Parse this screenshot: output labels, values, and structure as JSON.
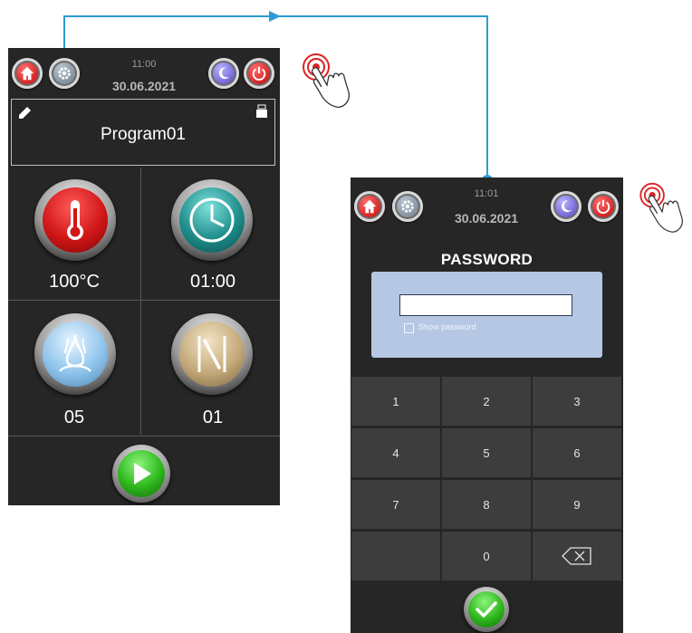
{
  "screen1": {
    "header": {
      "time": "11:00",
      "date": "30.06.2021"
    },
    "program": {
      "name": "Program01"
    },
    "tiles": [
      {
        "name": "temperature",
        "icon": "thermometer-icon",
        "value": "100°C"
      },
      {
        "name": "timer",
        "icon": "clock-icon",
        "value": "01:00"
      },
      {
        "name": "steam",
        "icon": "steam-icon",
        "value": "05"
      },
      {
        "name": "damper",
        "icon": "damper-icon",
        "value": "01"
      }
    ],
    "start_icon": "play-icon"
  },
  "screen2": {
    "header": {
      "time": "11:01",
      "date": "30.06.2021"
    },
    "title": "PASSWORD",
    "password": {
      "value": "",
      "show_password_label": "Show password",
      "show_password_checked": false
    },
    "keypad": [
      "1",
      "2",
      "3",
      "4",
      "5",
      "6",
      "7",
      "8",
      "9",
      "",
      "0",
      "⌫"
    ],
    "confirm_icon": "check-icon"
  },
  "colors": {
    "screen_bg": "#262626",
    "key_bg": "#3d3d3d",
    "panel_bg": "#b5c7e3",
    "connector": "#2b9bd6"
  }
}
